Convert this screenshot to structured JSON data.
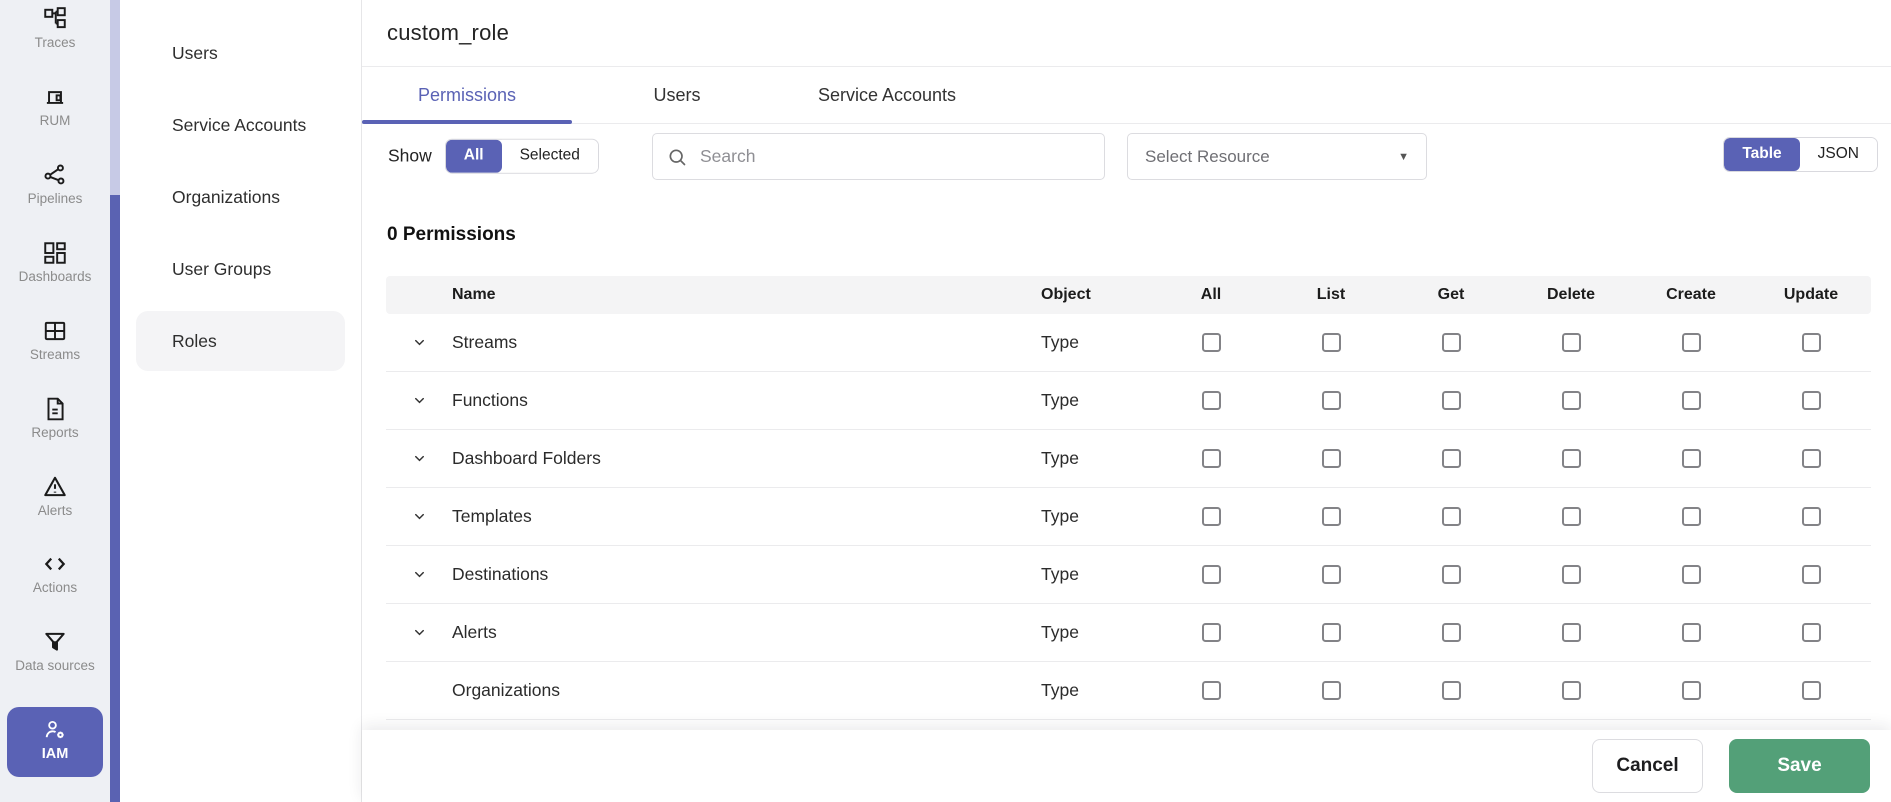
{
  "colors": {
    "accent": "#5a62b5",
    "save_green": "#53a078",
    "rail_bg": "#eef0f4",
    "scroll_track": "#c7cae6",
    "scroll_thumb": "#5a62b2"
  },
  "primary_nav": {
    "items": [
      {
        "label": "Traces",
        "icon": "traces-icon",
        "active": false
      },
      {
        "label": "RUM",
        "icon": "rum-icon",
        "active": false
      },
      {
        "label": "Pipelines",
        "icon": "pipelines-icon",
        "active": false
      },
      {
        "label": "Dashboards",
        "icon": "dashboards-icon",
        "active": false
      },
      {
        "label": "Streams",
        "icon": "streams-icon",
        "active": false
      },
      {
        "label": "Reports",
        "icon": "reports-icon",
        "active": false
      },
      {
        "label": "Alerts",
        "icon": "alerts-icon",
        "active": false
      },
      {
        "label": "Actions",
        "icon": "actions-icon",
        "active": false
      },
      {
        "label": "Data sources",
        "icon": "data-sources-icon",
        "active": false
      },
      {
        "label": "IAM",
        "icon": "iam-icon",
        "active": true
      }
    ]
  },
  "secondary_nav": {
    "items": [
      {
        "label": "Users",
        "active": false
      },
      {
        "label": "Service Accounts",
        "active": false
      },
      {
        "label": "Organizations",
        "active": false
      },
      {
        "label": "User Groups",
        "active": false
      },
      {
        "label": "Roles",
        "active": true
      }
    ]
  },
  "header": {
    "title": "custom_role"
  },
  "tabs": [
    {
      "label": "Permissions",
      "active": true
    },
    {
      "label": "Users",
      "active": false
    },
    {
      "label": "Service Accounts",
      "active": false
    }
  ],
  "controls": {
    "show_label": "Show",
    "show_toggle": [
      {
        "label": "All",
        "active": true
      },
      {
        "label": "Selected",
        "active": false
      }
    ],
    "search_placeholder": "Search",
    "resource_dropdown": "Select Resource",
    "view_toggle": [
      {
        "label": "Table",
        "active": true
      },
      {
        "label": "JSON",
        "active": false
      }
    ]
  },
  "permissions": {
    "count_label": "0 Permissions",
    "table": {
      "columns": [
        "Name",
        "Object",
        "All",
        "List",
        "Get",
        "Delete",
        "Create",
        "Update"
      ],
      "rows": [
        {
          "name": "Streams",
          "object": "Type",
          "expandable": true,
          "checks": [
            false,
            false,
            false,
            false,
            false,
            false
          ]
        },
        {
          "name": "Functions",
          "object": "Type",
          "expandable": true,
          "checks": [
            false,
            false,
            false,
            false,
            false,
            false
          ]
        },
        {
          "name": "Dashboard Folders",
          "object": "Type",
          "expandable": true,
          "checks": [
            false,
            false,
            false,
            false,
            false,
            false
          ]
        },
        {
          "name": "Templates",
          "object": "Type",
          "expandable": true,
          "checks": [
            false,
            false,
            false,
            false,
            false,
            false
          ]
        },
        {
          "name": "Destinations",
          "object": "Type",
          "expandable": true,
          "checks": [
            false,
            false,
            false,
            false,
            false,
            false
          ]
        },
        {
          "name": "Alerts",
          "object": "Type",
          "expandable": true,
          "checks": [
            false,
            false,
            false,
            false,
            false,
            false
          ]
        },
        {
          "name": "Organizations",
          "object": "Type",
          "expandable": false,
          "checks": [
            false,
            false,
            false,
            false,
            false,
            false
          ]
        }
      ]
    }
  },
  "footer": {
    "cancel_label": "Cancel",
    "save_label": "Save"
  }
}
